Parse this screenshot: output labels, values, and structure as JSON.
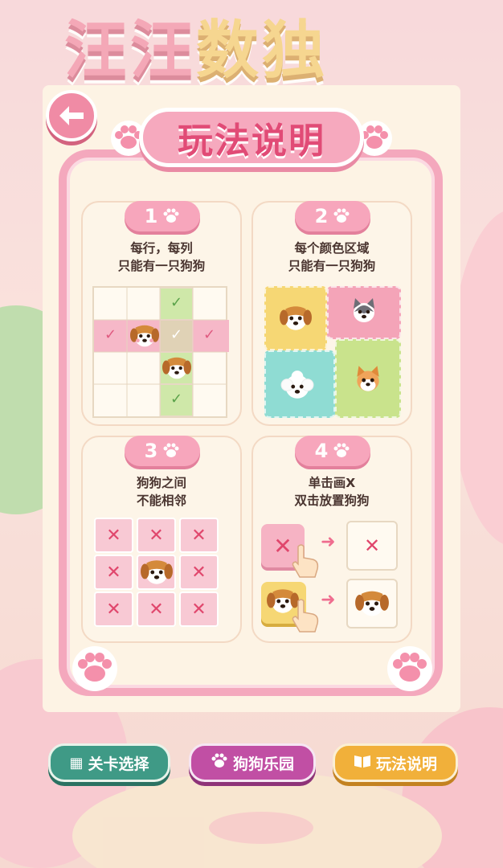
{
  "background": {
    "title_part1": "汪汪",
    "title_part2": "数独"
  },
  "modal": {
    "title": "玩法说明",
    "back_icon": "arrow-left-icon",
    "rules": [
      {
        "number": "1",
        "line1": "每行，每列",
        "line2": "只能有一只狗狗"
      },
      {
        "number": "2",
        "line1": "每个颜色区域",
        "line2": "只能有一只狗狗"
      },
      {
        "number": "3",
        "line1": "狗狗之间",
        "line2": "不能相邻"
      },
      {
        "number": "4",
        "line1": "单击画X",
        "line2": "双击放置狗狗"
      }
    ],
    "marks": {
      "check": "✓",
      "cross": "✕",
      "arrow": "➜"
    }
  },
  "nav": {
    "levels": {
      "label": "关卡选择",
      "icon": "map-icon"
    },
    "park": {
      "label": "狗狗乐园",
      "icon": "paw-icon"
    },
    "rules": {
      "label": "玩法说明",
      "icon": "book-icon"
    }
  },
  "colors": {
    "accent_pink": "#f4a8bd",
    "title_pink": "#e14b76",
    "check_green": "#cfe8a9",
    "region_yellow": "#f6d774",
    "region_pink": "#f4a4b8",
    "region_green": "#c9e38c",
    "region_teal": "#8fdcd3"
  }
}
